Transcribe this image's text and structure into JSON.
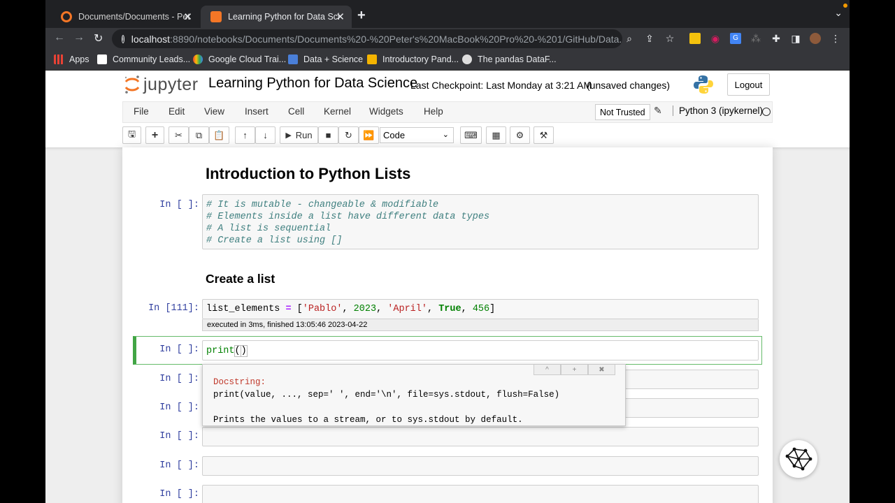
{
  "browser": {
    "tabs": [
      {
        "title": "Documents/Documents - Peter",
        "active": false
      },
      {
        "title": "Learning Python for Data Scien",
        "active": true
      }
    ],
    "url_host": "localhost",
    "url_path": ":8890/notebooks/Documents/Documents%20-%20Peter's%20MacBook%20Pro%20-%201/GitHub/Data...",
    "bookmarks": [
      "Apps",
      "Community Leads...",
      "Google Cloud Trai...",
      "Data + Science",
      "Introductory Pand...",
      "The pandas DataF..."
    ]
  },
  "jupyter": {
    "logo_text": "jupyter",
    "notebook_title": "Learning Python for Data Science",
    "checkpoint": "Last Checkpoint: Last Monday at 3:21 AM",
    "unsaved": "(unsaved changes)",
    "logout": "Logout",
    "menus": [
      "File",
      "Edit",
      "View",
      "Insert",
      "Cell",
      "Kernel",
      "Widgets",
      "Help"
    ],
    "trust": "Not Trusted",
    "kernel": "Python 3 (ipykernel)",
    "run_label": "Run",
    "cell_type": "Code"
  },
  "notebook": {
    "heading1": "Introduction to Python Lists",
    "cell1_prompt": "In [ ]:",
    "cell1_lines": [
      "# It is mutable - changeable & modifiable",
      "# Elements inside a list have different data types",
      "# A list is sequential",
      "# Create a list using []"
    ],
    "heading2": "Create a list",
    "cell2_prompt": "In [111]:",
    "cell2_code": {
      "var": "list_elements",
      "eq": "=",
      "open": " [",
      "s1": "'Pablo'",
      "n1": "2023",
      "s2": "'April'",
      "k1": "True",
      "n2": "456",
      "close": "]",
      "sep": ", "
    },
    "cell2_exec": "executed in 3ms, finished 13:05:46 2023-04-22",
    "cell3_prompt": "In [ ]:",
    "cell3_fn": "print",
    "cell3_paren_open": "(",
    "cell3_paren_close": ")",
    "empty_prompts": [
      "In [ ]:",
      "In [ ]:",
      "In [ ]:",
      "In [ ]:",
      "In [ ]:"
    ]
  },
  "tooltip": {
    "label": "Docstring:",
    "signature": "print(value, ..., sep=' ', end='\\n', file=sys.stdout, flush=False)",
    "description": "Prints the values to a stream, or to sys.stdout by default.",
    "btn_expand": "^",
    "btn_plus": "+",
    "btn_close": "✖"
  }
}
